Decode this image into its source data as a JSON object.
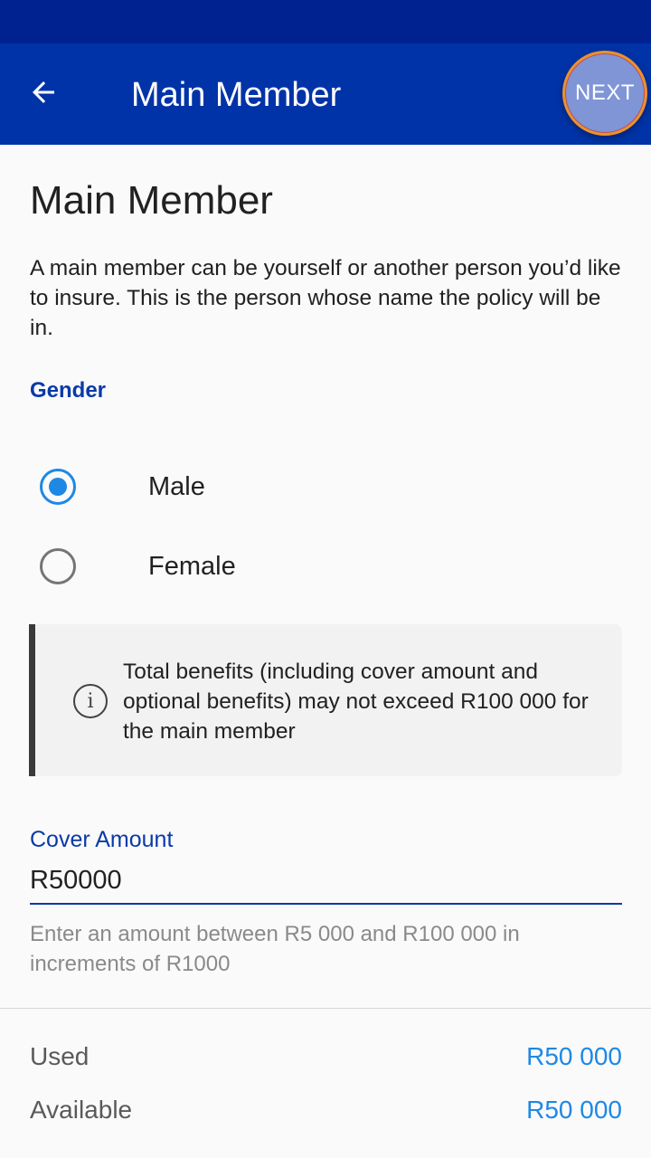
{
  "app_bar": {
    "title": "Main Member",
    "next_label": "NEXT",
    "back_icon": "arrow-left-icon"
  },
  "page": {
    "title": "Main Member",
    "intro": "A main member can be yourself or another person you’d like to insure. This is the person whose name the policy will be in."
  },
  "gender": {
    "label": "Gender",
    "options": [
      {
        "label": "Male",
        "selected": true
      },
      {
        "label": "Female",
        "selected": false
      }
    ]
  },
  "info": {
    "icon": "info-icon",
    "text": "Total benefits (including cover amount and optional benefits) may not exceed R100 000 for the main member"
  },
  "cover": {
    "label": "Cover Amount",
    "value": "R50000",
    "helper": "Enter an amount between R5 000 and R100 000 in increments of R1000"
  },
  "summary": {
    "used_label": "Used",
    "used_value": "R50 000",
    "available_label": "Available",
    "available_value": "R50 000"
  },
  "colors": {
    "status_bar": "#002291",
    "app_bar": "#0033a8",
    "accent_blue": "#1e88e5",
    "label_blue": "#0a3aa8"
  }
}
